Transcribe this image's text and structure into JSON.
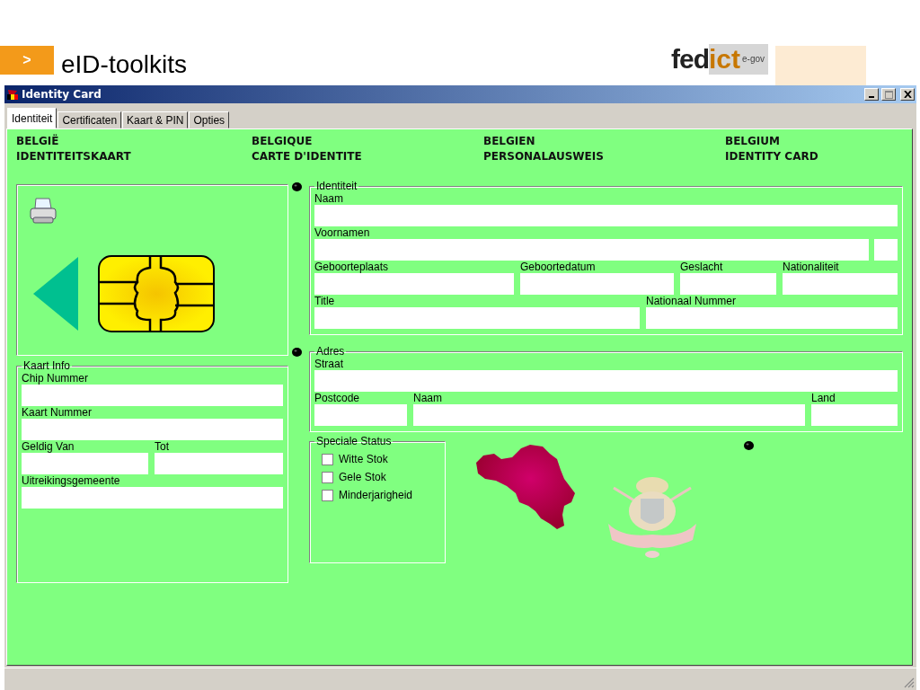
{
  "slide": {
    "title": "eID-toolkits",
    "bullet": ">",
    "logo": {
      "main": "fed",
      "accent": "ict",
      "sup": "e-gov"
    }
  },
  "window": {
    "title": "Identity Card"
  },
  "tabs": [
    {
      "label": "Identiteit",
      "selected": true
    },
    {
      "label": "Certificaten",
      "selected": false
    },
    {
      "label": "Kaart & PIN",
      "selected": false
    },
    {
      "label": "Opties",
      "selected": false
    }
  ],
  "header": [
    {
      "line1": "BELGIË",
      "line2": "IDENTITEITSKAART"
    },
    {
      "line1": "BELGIQUE",
      "line2": "CARTE D'IDENTITE"
    },
    {
      "line1": "BELGIEN",
      "line2": "PERSONALAUSWEIS"
    },
    {
      "line1": "BELGIUM",
      "line2": "IDENTITY CARD"
    }
  ],
  "card_info": {
    "legend": "Kaart Info",
    "fields": [
      {
        "label": "Chip Nummer"
      },
      {
        "label": "Kaart Nummer"
      },
      {
        "label": "Geldig Van"
      },
      {
        "label": "Tot"
      },
      {
        "label": "Uitreikingsgemeente"
      }
    ]
  },
  "identity": {
    "legend": "Identiteit",
    "fields": [
      {
        "label": "Naam"
      },
      {
        "label": "Voornamen",
        "extra_box": true
      },
      {
        "label": "Geboorteplaats"
      },
      {
        "label": "Geboortedatum"
      },
      {
        "label": "Geslacht"
      },
      {
        "label": "Nationaliteit"
      },
      {
        "label": "Title"
      },
      {
        "label": "Nationaal Nummer"
      }
    ]
  },
  "address": {
    "legend": "Adres",
    "fields": [
      {
        "label": "Straat"
      },
      {
        "label": "Postcode"
      },
      {
        "label": "Naam"
      },
      {
        "label": "Land"
      }
    ]
  },
  "status": {
    "legend": "Speciale Status",
    "items": [
      {
        "label": "Witte Stok",
        "checked": false
      },
      {
        "label": "Gele Stok",
        "checked": false
      },
      {
        "label": "Minderjarigheid",
        "checked": false
      }
    ]
  }
}
